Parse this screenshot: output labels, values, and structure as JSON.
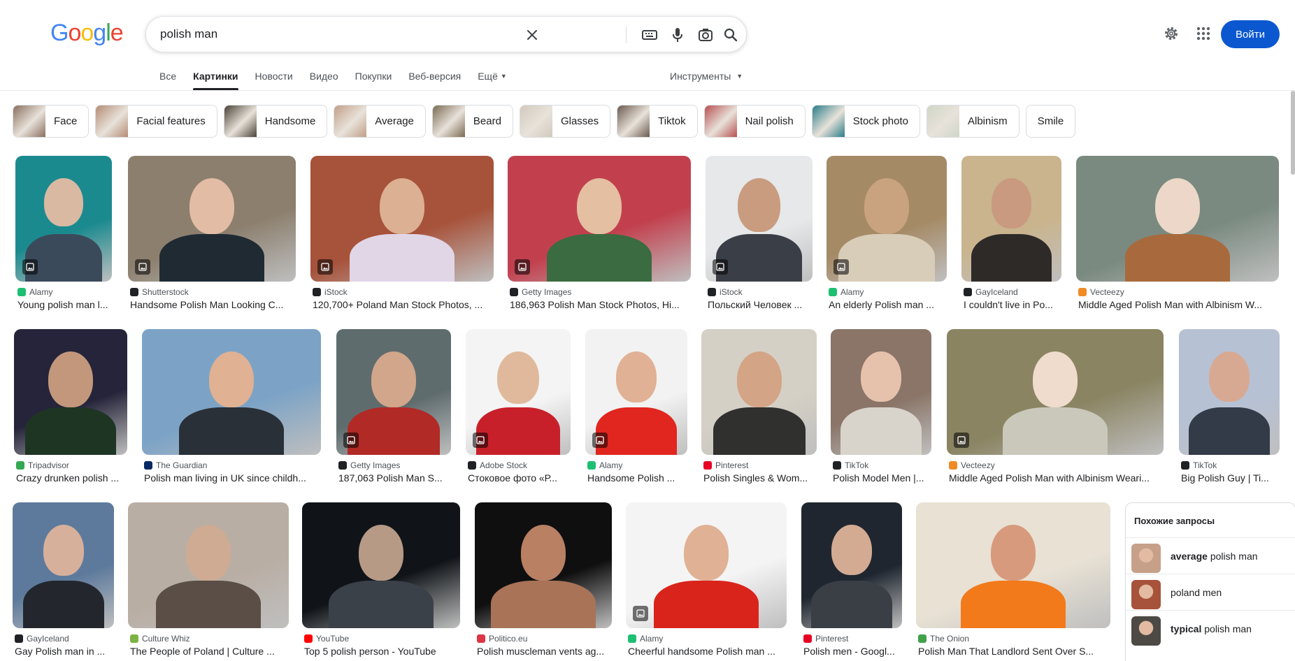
{
  "logo": {
    "letters": [
      "G",
      "o",
      "o",
      "g",
      "l",
      "e"
    ],
    "colors": [
      "#4285f4",
      "#ea4335",
      "#fbbc05",
      "#4285f4",
      "#34a853",
      "#ea4335"
    ]
  },
  "search": {
    "query": "polish man",
    "icons": [
      "close-icon",
      "keyboard-icon",
      "mic-icon",
      "camera-icon",
      "search-icon"
    ]
  },
  "header": {
    "login_label": "Войти",
    "icons": [
      "gear-icon",
      "apps-grid-icon"
    ]
  },
  "tabs": [
    {
      "label": "Все",
      "active": false
    },
    {
      "label": "Картинки",
      "active": true
    },
    {
      "label": "Новости",
      "active": false
    },
    {
      "label": "Видео",
      "active": false
    },
    {
      "label": "Покупки",
      "active": false
    },
    {
      "label": "Веб-версия",
      "active": false
    },
    {
      "label": "Ещё",
      "active": false
    }
  ],
  "tools_label": "Инструменты",
  "chips": [
    {
      "label": "Face",
      "tone": "#8a6f5e"
    },
    {
      "label": "Facial features",
      "tone": "#b48c74"
    },
    {
      "label": "Handsome",
      "tone": "#4a4238"
    },
    {
      "label": "Average",
      "tone": "#c29f88"
    },
    {
      "label": "Beard",
      "tone": "#7b6a52"
    },
    {
      "label": "Glasses",
      "tone": "#d2c9bd"
    },
    {
      "label": "Tiktok",
      "tone": "#6a5a4e"
    },
    {
      "label": "Nail polish",
      "tone": "#b85050"
    },
    {
      "label": "Stock photo",
      "tone": "#2a7d88"
    },
    {
      "label": "Albinism",
      "tone": "#cfd6c8"
    },
    {
      "label": "Smile",
      "tone": ""
    }
  ],
  "results": [
    {
      "source": "Alamy",
      "title": "Young polish man l...",
      "favicon": "#1dbf73",
      "bg": "#1b8a8f",
      "skin": "#d9b9a2",
      "shirt": "#3b4a5a"
    },
    {
      "source": "Shutterstock",
      "title": "Handsome Polish Man Looking C...",
      "favicon": "#202124",
      "bg": "#8c7f6e",
      "skin": "#e2bca4",
      "shirt": "#1f2a33"
    },
    {
      "source": "iStock",
      "title": "120,700+ Poland Man Stock Photos, ...",
      "favicon": "#202124",
      "bg": "#a7523a",
      "skin": "#dcb092",
      "shirt": "#e0d6e6"
    },
    {
      "source": "Getty Images",
      "title": "186,963 Polish Man Stock Photos, Hi...",
      "favicon": "#202124",
      "bg": "#c2404e",
      "skin": "#e4bfa2",
      "shirt": "#3b6b40"
    },
    {
      "source": "iStock",
      "title": "Польский Человек ...",
      "favicon": "#202124",
      "bg": "#e6e8ea",
      "skin": "#c99c7f",
      "shirt": "#3a3f47"
    },
    {
      "source": "Alamy",
      "title": "An elderly Polish man ...",
      "favicon": "#1dbf73",
      "bg": "#a58a66",
      "skin": "#c9a27f",
      "shirt": "#d7cdb8"
    },
    {
      "source": "GayIceland",
      "title": "I couldn't live in Po...",
      "favicon": "#202124",
      "bg": "#c9b48e",
      "skin": "#c99a7f",
      "shirt": "#2e2a28"
    },
    {
      "source": "Vecteezy",
      "title": "Middle Aged Polish Man with Albinism W...",
      "favicon": "#f08a24",
      "bg": "#7a8a80",
      "skin": "#edd7c8",
      "shirt": "#a86a3c"
    },
    {
      "source": "Tripadvisor",
      "title": "Crazy drunken polish ...",
      "favicon": "#34a853",
      "bg": "#26243a",
      "skin": "#c2977b",
      "shirt": "#1e3524"
    },
    {
      "source": "The Guardian",
      "title": "Polish man living in UK since childh...",
      "favicon": "#052962",
      "bg": "#7ca3c6",
      "skin": "#e0b192",
      "shirt": "#2a3038"
    },
    {
      "source": "Getty Images",
      "title": "187,063 Polish Man S...",
      "favicon": "#202124",
      "bg": "#5f6c6e",
      "skin": "#d2a68a",
      "shirt": "#b22a26"
    },
    {
      "source": "Adobe Stock",
      "title": "Стоковое фото «Р...",
      "favicon": "#202124",
      "bg": "#f4f4f4",
      "skin": "#e0b99c",
      "shirt": "#c8202a"
    },
    {
      "source": "Alamy",
      "title": "Handsome Polish ...",
      "favicon": "#1dbf73",
      "bg": "#f2f2f2",
      "skin": "#e0b194",
      "shirt": "#e0261f"
    },
    {
      "source": "Pinterest",
      "title": "Polish Singles & Wom...",
      "favicon": "#e60023",
      "bg": "#d5d0c5",
      "skin": "#d4a486",
      "shirt": "#30302e"
    },
    {
      "source": "TikTok",
      "title": "Polish Model Men |...",
      "favicon": "#202124",
      "bg": "#8a7568",
      "skin": "#e6c2ac",
      "shirt": "#d8d4cc"
    },
    {
      "source": "Vecteezy",
      "title": "Middle Aged Polish Man with Albinism Weari...",
      "favicon": "#f08a24",
      "bg": "#8a8462",
      "skin": "#f0dccd",
      "shirt": "#c9c8bb"
    },
    {
      "source": "TikTok",
      "title": "Big Polish Guy | Ti...",
      "favicon": "#202124",
      "bg": "#b7c1d4",
      "skin": "#d8a992",
      "shirt": "#333a48"
    },
    {
      "source": "GayIceland",
      "title": "Gay Polish man in ...",
      "favicon": "#202124",
      "bg": "#5d7a9c",
      "skin": "#d7b09b",
      "shirt": "#23272d"
    },
    {
      "source": "Culture Whiz",
      "title": "The People of Poland | Culture ...",
      "favicon": "#7cb342",
      "bg": "#b9aea4",
      "skin": "#cfab94",
      "shirt": "#5a4e46"
    },
    {
      "source": "YouTube",
      "title": "Top 5 polish person - YouTube",
      "favicon": "#ff0000",
      "bg": "#101418",
      "skin": "#b69a86",
      "shirt": "#3b4148"
    },
    {
      "source": "Politico.eu",
      "title": "Polish muscleman vents ag...",
      "favicon": "#dc3545",
      "bg": "#0f0f10",
      "skin": "#b98064",
      "shirt": "#a97358"
    },
    {
      "source": "Alamy",
      "title": "Cheerful handsome Polish man ...",
      "favicon": "#1dbf73",
      "bg": "#f4f4f4",
      "skin": "#e0b194",
      "shirt": "#d9241c"
    },
    {
      "source": "Pinterest",
      "title": "Polish men - Googl...",
      "favicon": "#e60023",
      "bg": "#1f2630",
      "skin": "#d3ab92",
      "shirt": "#3a3f46"
    },
    {
      "source": "The Onion",
      "title": "Polish Man That Landlord Sent Over S...",
      "favicon": "#3fa14a",
      "bg": "#e8e1d4",
      "skin": "#d79a7c",
      "shirt": "#f27a1a"
    }
  ],
  "related": {
    "title": "Похожие запросы",
    "items": [
      {
        "bold": "average",
        "rest": " polish man",
        "tone": "#c7a08a"
      },
      {
        "bold": "",
        "rest": "poland men",
        "tone": "#a7523a"
      },
      {
        "bold": "typical",
        "rest": " polish man",
        "tone": "#4d4a46"
      }
    ]
  }
}
